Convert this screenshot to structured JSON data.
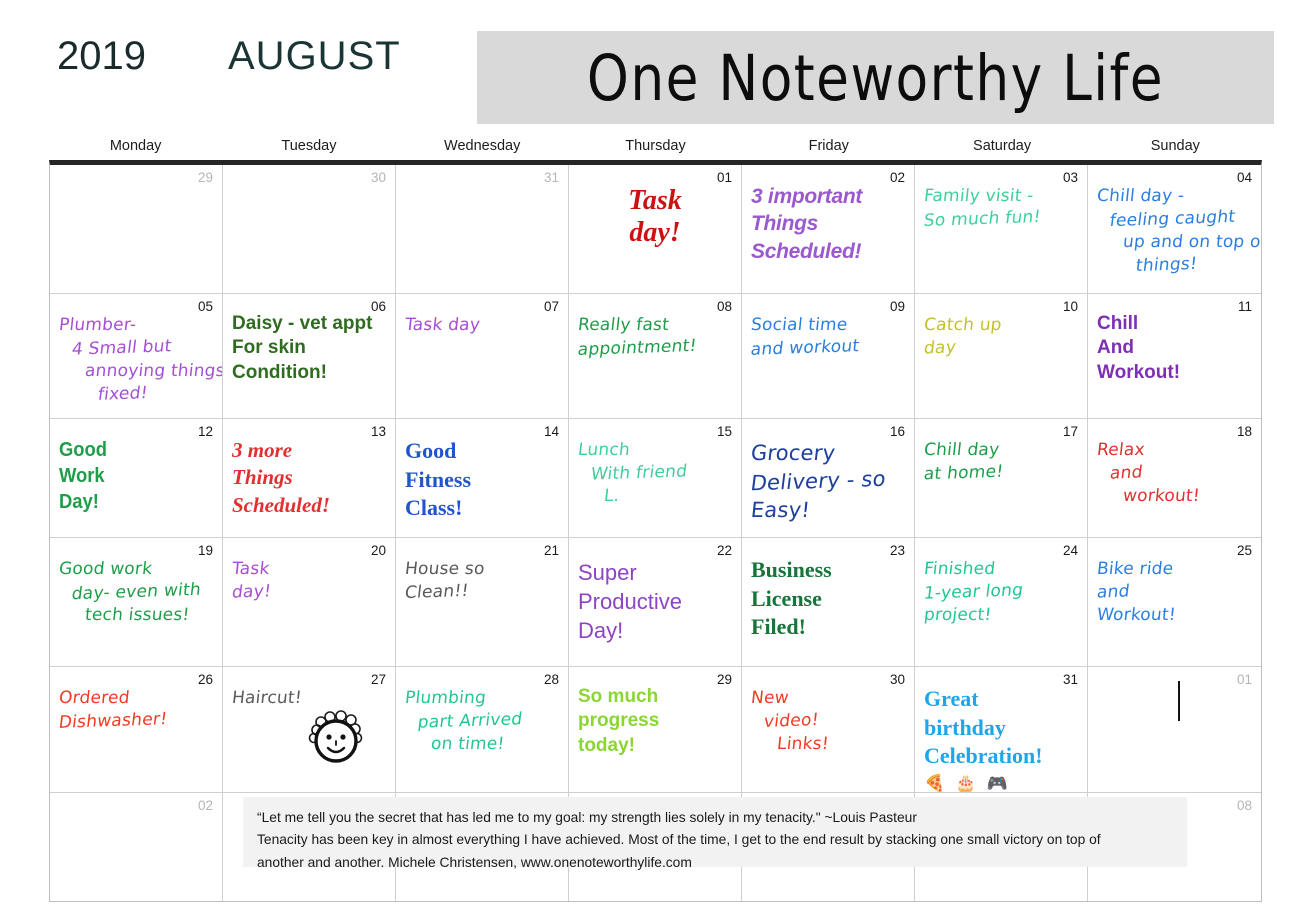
{
  "header": {
    "year": "2019",
    "month": "AUGUST",
    "banner_title": "One Noteworthy Life"
  },
  "weekdays": [
    "Monday",
    "Tuesday",
    "Wednesday",
    "Thursday",
    "Friday",
    "Saturday",
    "Sunday"
  ],
  "colors": {
    "purple": "#9b59d0",
    "purple_dark": "#7d2fb5",
    "purple_med": "#8e44c4",
    "violet": "#a64fd6",
    "red": "#e03030",
    "red_dark": "#cc1111",
    "red_orange": "#f03c22",
    "green": "#1f9e4a",
    "green_dark": "#2f6b20",
    "green_bright": "#27c07a",
    "green_teal": "#22c88d",
    "green_mint": "#3ecf9a",
    "green_forest": "#17743a",
    "blue": "#2a7fe0",
    "blue_dark": "#1d3f9e",
    "blue_bright": "#1fa5e8",
    "blue_royal": "#2255cc",
    "olive": "#c2c22a",
    "lime": "#8bd633",
    "gray": "#5a5a5a",
    "muted": "#b5b5b5",
    "banner_bg": "#d9d9d9",
    "quote_bg": "#f2f2f2"
  },
  "weeks": [
    {
      "days": [
        {
          "num": "29",
          "muted": true,
          "note": null
        },
        {
          "num": "30",
          "muted": true,
          "note": null
        },
        {
          "num": "31",
          "muted": true,
          "note": null
        },
        {
          "num": "01",
          "muted": false,
          "note": {
            "style": "script",
            "color": "#cc1111",
            "lines": [
              "Task",
              "day!"
            ]
          }
        },
        {
          "num": "02",
          "muted": false,
          "note": {
            "style": "italic-bold",
            "color": "#9b59d0",
            "lines": [
              "3 important",
              "Things",
              "Scheduled!"
            ]
          }
        },
        {
          "num": "03",
          "muted": false,
          "note": {
            "style": "hand",
            "color": "#3ecf9a",
            "lines": [
              "Family visit -",
              "So much fun!"
            ]
          }
        },
        {
          "num": "04",
          "muted": false,
          "note": {
            "style": "hand-stagger",
            "color": "#2a7fe0",
            "lines": [
              "Chill day -",
              "feeling caught",
              "up and on top of",
              "things!"
            ]
          }
        }
      ]
    },
    {
      "days": [
        {
          "num": "05",
          "muted": false,
          "note": {
            "style": "hand-stagger",
            "color": "#a64fd6",
            "lines": [
              "Plumber-",
              "4 Small but",
              "annoying things",
              "fixed!"
            ]
          }
        },
        {
          "num": "06",
          "muted": false,
          "note": {
            "style": "typed",
            "color": "#2f6b20",
            "lines": [
              "Daisy - vet appt",
              "For skin",
              "Condition!"
            ]
          }
        },
        {
          "num": "07",
          "muted": false,
          "note": {
            "style": "hand",
            "color": "#a64fd6",
            "lines": [
              "Task day"
            ]
          }
        },
        {
          "num": "08",
          "muted": false,
          "note": {
            "style": "hand",
            "color": "#1f9e4a",
            "lines": [
              "Really fast",
              "appointment!"
            ]
          }
        },
        {
          "num": "09",
          "muted": false,
          "note": {
            "style": "hand",
            "color": "#2a7fe0",
            "lines": [
              "Social time",
              "and workout"
            ]
          }
        },
        {
          "num": "10",
          "muted": false,
          "note": {
            "style": "hand",
            "color": "#c2c22a",
            "lines": [
              "Catch up",
              "day"
            ]
          }
        },
        {
          "num": "11",
          "muted": false,
          "note": {
            "style": "typed",
            "color": "#7d2fb5",
            "lines": [
              "Chill",
              "And",
              "Workout!"
            ]
          }
        }
      ]
    },
    {
      "days": [
        {
          "num": "12",
          "muted": false,
          "note": {
            "style": "typed-cond",
            "color": "#1f9e4a",
            "lines": [
              "Good",
              "Work",
              "Day!"
            ]
          }
        },
        {
          "num": "13",
          "muted": false,
          "note": {
            "style": "serif-italic",
            "color": "#e03030",
            "lines": [
              "3 more",
              "Things",
              "Scheduled!"
            ]
          }
        },
        {
          "num": "14",
          "muted": false,
          "note": {
            "style": "serif-bold",
            "color": "#2255cc",
            "lines": [
              "Good",
              "Fitness",
              "Class!"
            ]
          }
        },
        {
          "num": "15",
          "muted": false,
          "note": {
            "style": "hand-stagger",
            "color": "#3ecf9a",
            "lines": [
              "Lunch",
              "With friend",
              "L."
            ]
          }
        },
        {
          "num": "16",
          "muted": false,
          "note": {
            "style": "hand-big",
            "color": "#1d3f9e",
            "lines": [
              "Grocery",
              "Delivery - so",
              "Easy!"
            ]
          }
        },
        {
          "num": "17",
          "muted": false,
          "note": {
            "style": "hand",
            "color": "#1f9e4a",
            "lines": [
              "Chill day",
              "at home!"
            ]
          }
        },
        {
          "num": "18",
          "muted": false,
          "note": {
            "style": "hand-stagger",
            "color": "#e03030",
            "lines": [
              "Relax",
              "and",
              "workout!"
            ]
          }
        }
      ]
    },
    {
      "days": [
        {
          "num": "19",
          "muted": false,
          "note": {
            "style": "hand-stagger",
            "color": "#1f9e4a",
            "lines": [
              "Good work",
              "day- even with",
              "tech issues!"
            ]
          }
        },
        {
          "num": "20",
          "muted": false,
          "note": {
            "style": "hand",
            "color": "#a64fd6",
            "lines": [
              "Task",
              "day!"
            ]
          }
        },
        {
          "num": "21",
          "muted": false,
          "note": {
            "style": "hand",
            "color": "#5a5a5a",
            "lines": [
              "House so",
              "Clean!!"
            ]
          }
        },
        {
          "num": "22",
          "muted": false,
          "note": {
            "style": "typed-big",
            "color": "#8e44c4",
            "lines": [
              "Super",
              "Productive",
              "Day!"
            ]
          }
        },
        {
          "num": "23",
          "muted": false,
          "note": {
            "style": "serif-bold",
            "color": "#17743a",
            "lines": [
              "Business",
              "License",
              "Filed!"
            ]
          }
        },
        {
          "num": "24",
          "muted": false,
          "note": {
            "style": "hand",
            "color": "#22c88d",
            "lines": [
              "Finished",
              "1-year long",
              "project!"
            ]
          }
        },
        {
          "num": "25",
          "muted": false,
          "note": {
            "style": "hand",
            "color": "#2a7fe0",
            "lines": [
              "Bike ride",
              "and",
              "Workout!"
            ]
          }
        }
      ]
    },
    {
      "days": [
        {
          "num": "26",
          "muted": false,
          "note": {
            "style": "hand",
            "color": "#f03c22",
            "lines": [
              "Ordered",
              "Dishwasher!"
            ]
          }
        },
        {
          "num": "27",
          "muted": false,
          "note": {
            "style": "hand",
            "color": "#5a5a5a",
            "lines": [
              "Haircut!"
            ],
            "drawing": "smiley-face-doodle"
          }
        },
        {
          "num": "28",
          "muted": false,
          "note": {
            "style": "hand-stagger",
            "color": "#22c88d",
            "lines": [
              "Plumbing",
              "part Arrived",
              "on time!"
            ]
          }
        },
        {
          "num": "29",
          "muted": false,
          "note": {
            "style": "typed",
            "color": "#8bd633",
            "lines": [
              "So much",
              "progress",
              "today!"
            ]
          }
        },
        {
          "num": "30",
          "muted": false,
          "note": {
            "style": "hand-stagger",
            "color": "#f03c22",
            "lines": [
              "New",
              "video!",
              "Links!"
            ]
          }
        },
        {
          "num": "31",
          "muted": false,
          "note": {
            "style": "serif-bold",
            "color": "#1fa5e8",
            "lines": [
              "Great",
              "birthday",
              "Celebration!"
            ],
            "emojis": "🍕 🎂 🎮"
          }
        },
        {
          "num": "01",
          "muted": true,
          "note": null,
          "caret": true
        }
      ]
    },
    {
      "days": [
        {
          "num": "02",
          "muted": true,
          "note": null
        },
        {
          "num": "",
          "muted": true,
          "note": null
        },
        {
          "num": "",
          "muted": true,
          "note": null
        },
        {
          "num": "",
          "muted": true,
          "note": null
        },
        {
          "num": "",
          "muted": true,
          "note": null
        },
        {
          "num": "",
          "muted": true,
          "note": null
        },
        {
          "num": "08",
          "muted": true,
          "note": null
        }
      ]
    }
  ],
  "quote": {
    "line1": "“Let me tell you the secret that has led me to my goal: my strength lies solely in my tenacity.\" ~Louis Pasteur",
    "line2": "Tenacity has been key in almost everything I have achieved. Most of the time, I get to the end result by stacking one small victory on top of",
    "line3": "another and another. Michele Christensen, www.onenoteworthylife.com"
  }
}
